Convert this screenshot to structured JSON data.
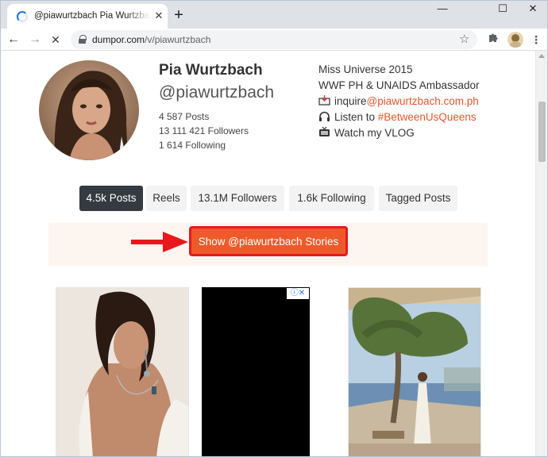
{
  "browser": {
    "tab_title": "@piawurtzbach Pia Wurtzbach Instagram",
    "tab_close": "✕",
    "new_tab": "+",
    "window_buttons": {
      "minimize": "—",
      "maximize": "☐",
      "close": "✕"
    },
    "nav": {
      "back": "←",
      "forward": "→",
      "reload": "✕"
    },
    "url_host": "dumpor.com",
    "url_path": "/v/piawurtzbach",
    "bookmark_star": "☆",
    "extensions_icon": "puzzle-icon"
  },
  "profile": {
    "name": "Pia Wurtzbach",
    "handle": "@piawurtzbach",
    "posts": "4 587 Posts",
    "followers": "13 111 421 Followers",
    "following": "1 614 Following",
    "bio": {
      "line1": "Miss Universe 2015",
      "line2": "WWF PH & UNAIDS Ambassador",
      "inquire_prefix": "inquire",
      "inquire_email": "@piawurtzbach.com.ph",
      "listen_prefix": "Listen to ",
      "listen_tag": "#BetweenUsQueens",
      "watch": "Watch my VLOG"
    }
  },
  "tabs": [
    {
      "label": "4.5k Posts",
      "active": true
    },
    {
      "label": "Reels",
      "active": false
    },
    {
      "label": "13.1M Followers",
      "active": false
    },
    {
      "label": "1.6k Following",
      "active": false
    },
    {
      "label": "Tagged Posts",
      "active": false
    }
  ],
  "stories_button": "Show @piawurtzbach Stories",
  "ad_badge": "ⓘ✕",
  "colors": {
    "accent": "#e8562a",
    "stories_button": "#ef5a2a",
    "annotation_arrow": "#e8181c",
    "active_tab": "#343a40"
  }
}
